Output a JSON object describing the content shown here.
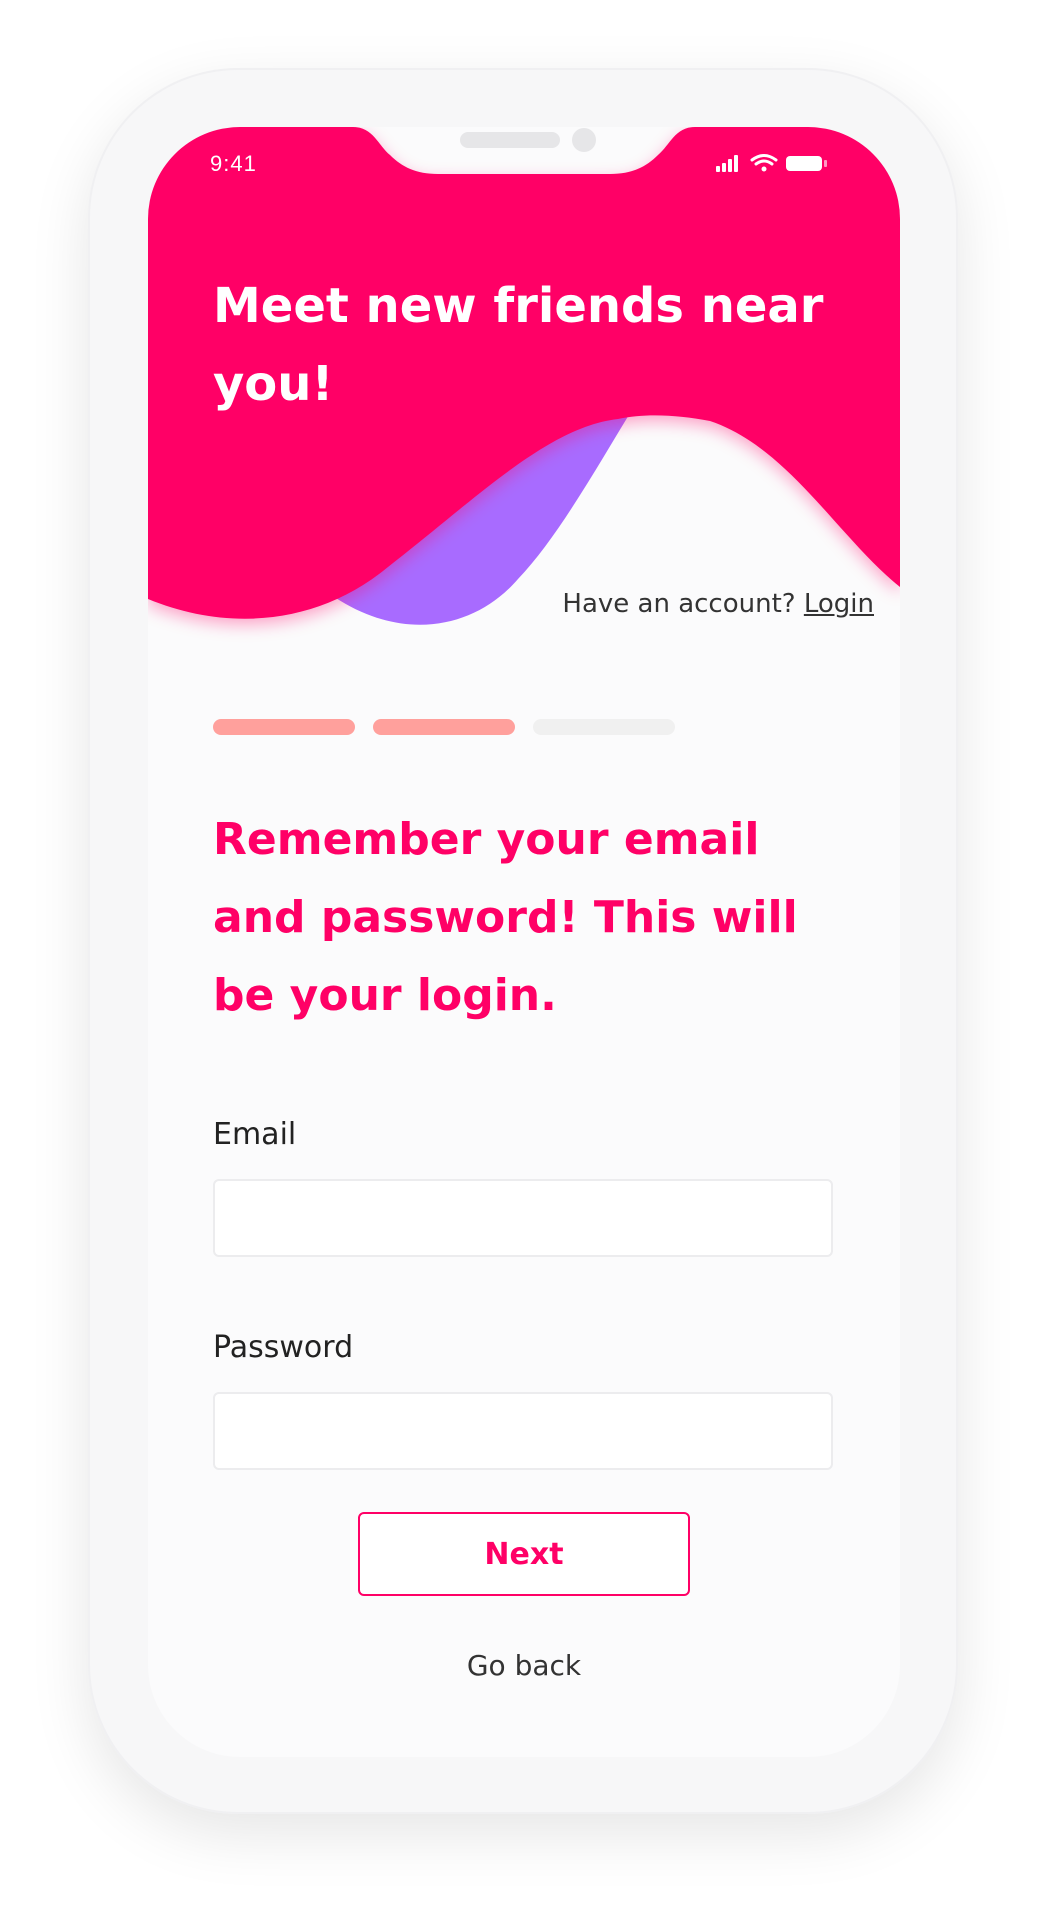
{
  "status_bar": {
    "time": "9:41",
    "icons": [
      "signal-icon",
      "wifi-icon",
      "battery-icon"
    ]
  },
  "hero": {
    "headline": "Meet new friends near you!",
    "account_prompt": "Have an account?",
    "login_link": "Login"
  },
  "progress": {
    "total_steps": 3,
    "completed_steps": 2
  },
  "main": {
    "title": "Remember your email and password! This will be your login.",
    "email": {
      "label": "Email",
      "value": "",
      "placeholder": ""
    },
    "password": {
      "label": "Password",
      "value": "",
      "placeholder": ""
    },
    "next_label": "Next",
    "back_label": "Go back"
  },
  "colors": {
    "brand_pink": "#ff0066",
    "wave_purple": "#a86bff",
    "progress_done": "#ffa09c",
    "progress_todo": "#f0f0f0"
  }
}
